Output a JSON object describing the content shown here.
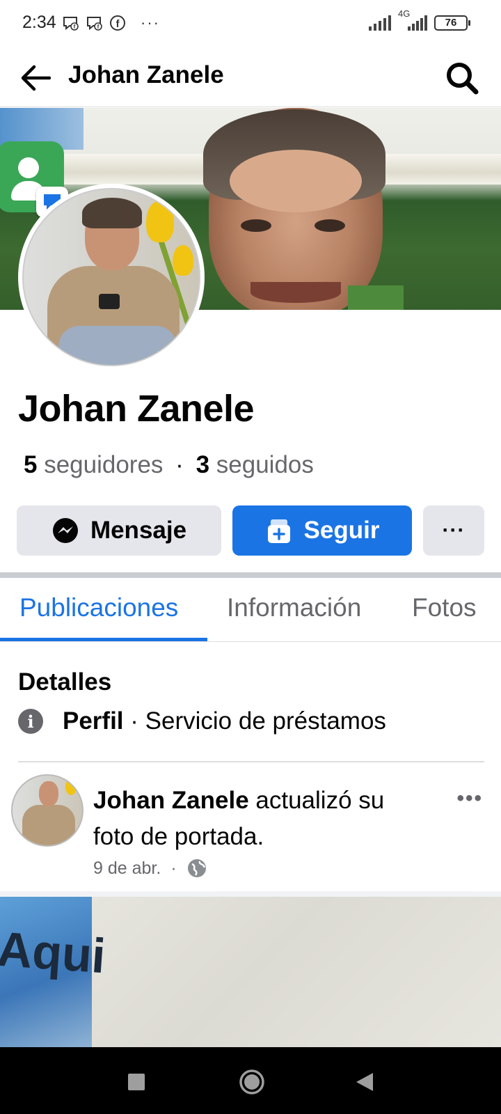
{
  "status_bar": {
    "time": "2:34",
    "left_icons": [
      "messenger-icon",
      "messenger-icon",
      "facebook-icon"
    ],
    "more": "···",
    "network": "4G",
    "battery": "76"
  },
  "header": {
    "title": "Johan Zanele",
    "back_icon": "arrow-left-icon",
    "search_icon": "search-icon"
  },
  "profile": {
    "name": "Johan Zanele",
    "followers_count": "5",
    "followers_label": "seguidores",
    "separator": "·",
    "following_count": "3",
    "following_label": "seguidos"
  },
  "actions": {
    "message_label": "Mensaje",
    "follow_label": "Seguir",
    "more_label": "···"
  },
  "tabs": [
    {
      "label": "Publicaciones",
      "active": true
    },
    {
      "label": "Información",
      "active": false
    },
    {
      "label": "Fotos",
      "active": false
    }
  ],
  "details": {
    "title": "Detalles",
    "type_label": "Perfil",
    "category": "· Servicio de préstamos"
  },
  "post": {
    "author": "Johan Zanele",
    "action": " actualizó su foto de portada.",
    "date": "9 de abr.",
    "dot": "·",
    "more": "•••",
    "image_text": "Aqui"
  },
  "colors": {
    "accent": "#1b74e4",
    "button_gray": "#e4e6eb",
    "secondary_text": "#65676b"
  }
}
